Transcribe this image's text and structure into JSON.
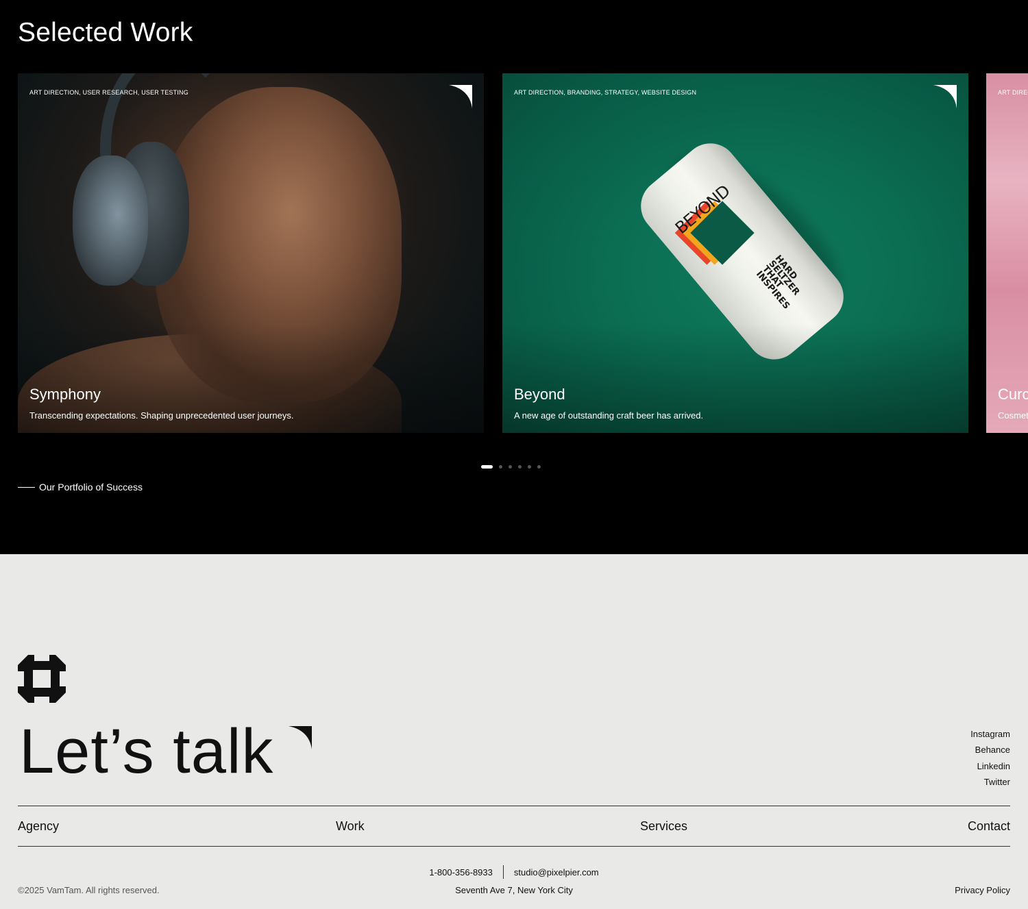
{
  "work": {
    "title": "Selected Work",
    "cards": [
      {
        "tags": "ART DIRECTION, USER RESEARCH, USER TESTING",
        "title": "Symphony",
        "description": "Transcending expectations. Shaping unprecedented user journeys.",
        "image": "man-with-headphones-portrait",
        "color": "#1a1714"
      },
      {
        "tags": "ART DIRECTION, BRANDING, STRATEGY, WEBSITE DESIGN",
        "title": "Beyond",
        "description": "A new age of outstanding craft beer has arrived.",
        "image": "beyond-hard-seltzer-can",
        "color": "#0b6e53",
        "can_brand": "BEYOND",
        "can_text": "HARD SELTZER THAT INSPIRES"
      },
      {
        "tags": "ART DIREC",
        "title": "Curc",
        "description": "Cosmet",
        "image": "pink-cosmetic-texture",
        "color": "#e1a3b4"
      }
    ],
    "pagination": {
      "total": 6,
      "active": 0
    },
    "portfolio_label": "Our Portfolio of Success"
  },
  "footer": {
    "logo": "flower-logo-icon",
    "headline": "Let’s talk",
    "socials": [
      "Instagram",
      "Behance",
      "Linkedin",
      "Twitter"
    ],
    "nav": [
      "Agency",
      "Work",
      "Services",
      "Contact"
    ],
    "phone": "1-800-356-8933",
    "email": "studio@pixelpier.com",
    "address": "Seventh Ave 7, New York City",
    "copyright": "©2025 VamTam. All rights reserved.",
    "privacy": "Privacy Policy"
  },
  "colors": {
    "dark_bg": "#000000",
    "light_bg": "#e9e9e7",
    "text_dark": "#111111",
    "beyond_green": "#0b6e53"
  }
}
